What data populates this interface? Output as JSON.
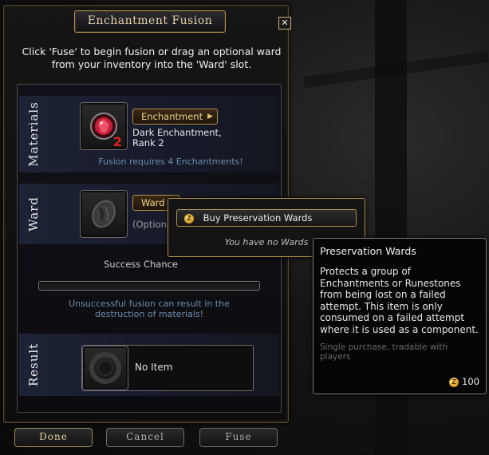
{
  "window": {
    "title": "Enchantment Fusion",
    "close_glyph": "✕",
    "intro": "Click 'Fuse' to begin fusion or drag an optional ward from your inventory into the 'Ward' slot."
  },
  "materials": {
    "section_label": "Materials",
    "dropdown_label": "Enchantment",
    "item_name": "Dark Enchantment, Rank 2",
    "item_count": "2",
    "requirement_note": "Fusion requires 4 Enchantments!"
  },
  "ward": {
    "section_label": "Ward",
    "dropdown_label": "Ward",
    "optional_text": "(Optional"
  },
  "success": {
    "label": "Success Chance",
    "progress_fraction": 0
  },
  "warning": "Unsuccessful fusion can result in the destruction of materials!",
  "result": {
    "section_label": "Result",
    "empty_text": "No Item"
  },
  "buttons": {
    "done": "Done",
    "cancel": "Cancel",
    "fuse": "Fuse"
  },
  "ward_menu": {
    "buy_label": "Buy Preservation Wards",
    "empty_text": "You have no Wards"
  },
  "tooltip": {
    "title": "Preservation Wards",
    "description": "Protects a group of Enchantments or Runestones from being lost on a failed attempt. This item is only consumed on a failed attempt where it is used as a component.",
    "purchase_note": "Single purchase, tradable with players",
    "price": "100"
  },
  "icons": {
    "currency": "zen-coin-icon",
    "enchantment": "red-gem-icon",
    "ward": "ward-stone-icon",
    "result": "empty-ring-icon"
  },
  "colors": {
    "accent_gold": "#b09050",
    "note_blue": "#6e8cae",
    "count_red": "#e02020"
  }
}
